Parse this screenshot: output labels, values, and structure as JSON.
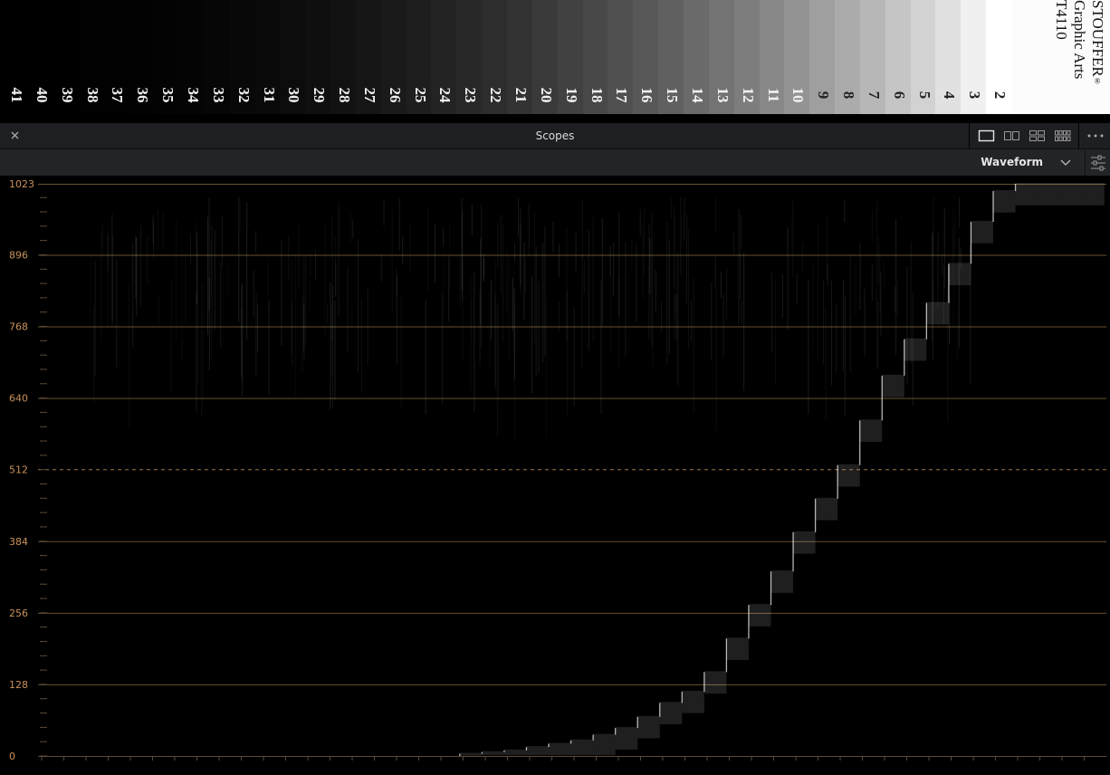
{
  "step_wedge": {
    "step_numbers": [
      "41",
      "40",
      "39",
      "38",
      "37",
      "36",
      "35",
      "34",
      "33",
      "32",
      "31",
      "30",
      "29",
      "28",
      "27",
      "26",
      "25",
      "24",
      "23",
      "22",
      "21",
      "20",
      "19",
      "18",
      "17",
      "16",
      "15",
      "14",
      "13",
      "12",
      "11",
      "10",
      "9",
      "8",
      "7",
      "6",
      "5",
      "4",
      "3",
      "2"
    ],
    "brand": {
      "name": "STOUFFER",
      "mark": "®",
      "subtitle": "Graphic Arts",
      "model": "T4110"
    }
  },
  "header": {
    "title": "Scopes",
    "close_icon": "close-icon",
    "layout_icons": [
      "layout-single-icon",
      "layout-dual-icon",
      "layout-quad-icon",
      "layout-eight-icon"
    ],
    "more_icon": "ellipsis-icon"
  },
  "subheader": {
    "scope_type": "Waveform",
    "chevron_icon": "chevron-down-icon",
    "settings_icon": "sliders-icon"
  },
  "colors": {
    "accent": "#c8915a",
    "gridline": "#6b5131",
    "panel": "#1e1f22",
    "trace": "#ffffff"
  },
  "chart_data": {
    "type": "scatter",
    "title": "",
    "xlabel": "",
    "ylabel": "",
    "ylim": [
      0,
      1023
    ],
    "y_ticks": [
      "1023",
      "896",
      "768",
      "640",
      "512",
      "384",
      "256",
      "128",
      "0"
    ],
    "grid": true,
    "midline": 512,
    "series": [
      {
        "values": [
          0,
          0,
          0,
          0,
          0,
          0,
          0,
          0,
          0,
          0,
          0,
          0,
          0,
          0,
          0,
          0,
          4,
          7,
          10,
          16,
          22,
          28,
          38,
          50,
          70,
          95,
          115,
          150,
          210,
          270,
          330,
          400,
          460,
          520,
          600,
          680,
          745,
          810,
          880,
          955,
          1010,
          1023,
          1023,
          1023,
          1023
        ]
      }
    ]
  }
}
